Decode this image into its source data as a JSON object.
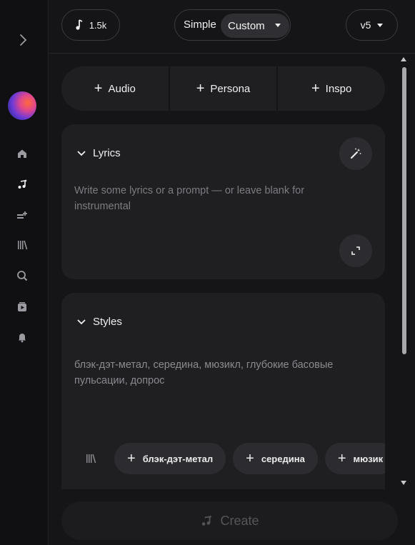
{
  "topbar": {
    "credits": "1.5k",
    "mode_simple": "Simple",
    "mode_custom": "Custom",
    "version": "v5"
  },
  "add_row": {
    "audio": "Audio",
    "persona": "Persona",
    "inspo": "Inspo"
  },
  "lyrics": {
    "heading": "Lyrics",
    "placeholder": "Write some lyrics or a prompt — or leave blank for instrumental"
  },
  "styles": {
    "heading": "Styles",
    "text": "блэк-дэт-метал, середина, мюзикл, глубокие басовые пульсации, допрос",
    "chips": [
      "блэк-дэт-метал",
      "середина",
      "мюзик"
    ]
  },
  "create_label": "Create",
  "icons": {
    "rail": [
      "chevron-right-icon",
      "home-icon",
      "create-music-icon",
      "playlist-add-icon",
      "library-icon",
      "search-icon",
      "video-icon",
      "bell-icon"
    ]
  },
  "colors": {
    "background": "#151517",
    "panel": "#1f1f22",
    "muted_text": "#7c7c82"
  }
}
